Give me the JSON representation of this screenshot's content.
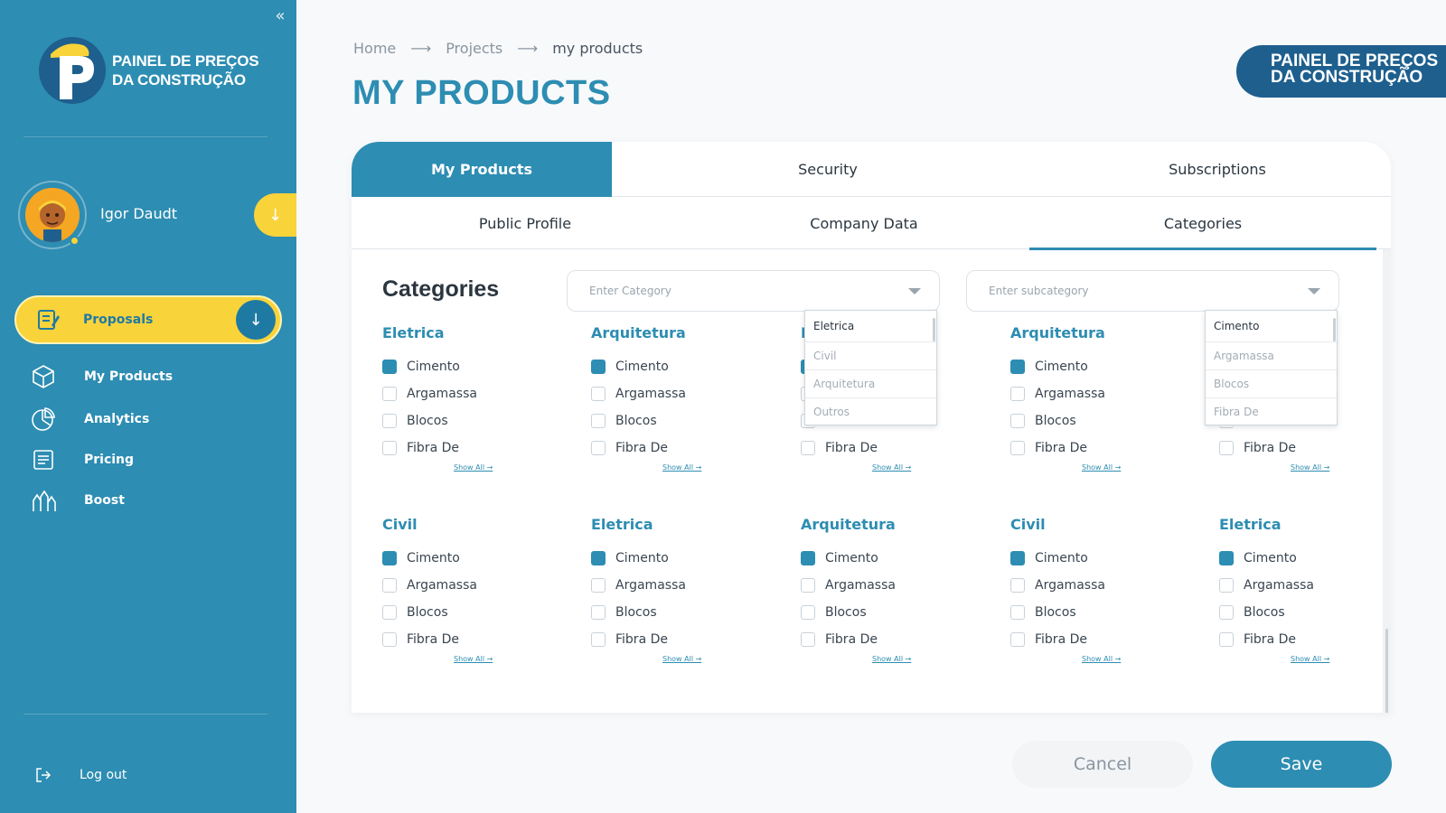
{
  "sidebar": {
    "logo_line1": "PAINEL DE PREÇOS",
    "logo_line2": "DA CONSTRUÇÃO",
    "user_name": "Igor Daudt",
    "proposals_label": "Proposals",
    "items": [
      {
        "label": "My Products",
        "icon": "box-icon"
      },
      {
        "label": "Analytics",
        "icon": "pie-chart-icon"
      },
      {
        "label": "Pricing",
        "icon": "price-list-icon"
      },
      {
        "label": "Boost",
        "icon": "boost-icon"
      }
    ],
    "logout_label": "Log out"
  },
  "breadcrumb": [
    "Home",
    "Projects",
    "my products"
  ],
  "page_title": "MY PRODUCTS",
  "brand_badge": {
    "line1": "PAINEL DE PREÇOS",
    "line2": "DA CONSTRUÇÃO"
  },
  "tabs_top": [
    "My Products",
    "Security",
    "Subscriptions"
  ],
  "tabs_sub": [
    "Public Profile",
    "Company Data",
    "Categories"
  ],
  "categories": {
    "heading": "Categories",
    "category_placeholder": "Enter Category",
    "subcategory_placeholder": "Enter subcategory",
    "show_all_label": "Show All →",
    "category_dropdown": [
      "Eletrica",
      "Civil",
      "Arquitetura",
      "Outros"
    ],
    "subcategory_dropdown": [
      "Cimento",
      "Argamassa",
      "Blocos",
      "Fibra De"
    ],
    "groups": [
      {
        "title": "Eletrica",
        "options": [
          "Cimento",
          "Argamassa",
          "Blocos",
          "Fibra De"
        ],
        "checked": [
          true,
          false,
          false,
          false
        ]
      },
      {
        "title": "Arquitetura",
        "options": [
          "Cimento",
          "Argamassa",
          "Blocos",
          "Fibra De"
        ],
        "checked": [
          true,
          false,
          false,
          false
        ]
      },
      {
        "title": "Eletrica",
        "options": [
          "Cimento",
          "Argamassa",
          "Blocos",
          "Fibra De"
        ],
        "checked": [
          true,
          false,
          false,
          false
        ]
      },
      {
        "title": "Arquitetura",
        "options": [
          "Cimento",
          "Argamassa",
          "Blocos",
          "Fibra De"
        ],
        "checked": [
          true,
          false,
          false,
          false
        ]
      },
      {
        "title": "Eletrica",
        "options": [
          "Cimento",
          "Argamassa",
          "Blocos",
          "Fibra De"
        ],
        "checked": [
          true,
          false,
          false,
          false
        ]
      },
      {
        "title": "Civil",
        "options": [
          "Cimento",
          "Argamassa",
          "Blocos",
          "Fibra De"
        ],
        "checked": [
          true,
          false,
          false,
          false
        ]
      },
      {
        "title": "Eletrica",
        "options": [
          "Cimento",
          "Argamassa",
          "Blocos",
          "Fibra De"
        ],
        "checked": [
          true,
          false,
          false,
          false
        ]
      },
      {
        "title": "Arquitetura",
        "options": [
          "Cimento",
          "Argamassa",
          "Blocos",
          "Fibra De"
        ],
        "checked": [
          true,
          false,
          false,
          false
        ]
      },
      {
        "title": "Civil",
        "options": [
          "Cimento",
          "Argamassa",
          "Blocos",
          "Fibra De"
        ],
        "checked": [
          true,
          false,
          false,
          false
        ]
      },
      {
        "title": "Eletrica",
        "options": [
          "Cimento",
          "Argamassa",
          "Blocos",
          "Fibra De"
        ],
        "checked": [
          true,
          false,
          false,
          false
        ]
      }
    ]
  },
  "actions": {
    "cancel_label": "Cancel",
    "save_label": "Save"
  },
  "colors": {
    "primary": "#2d8db2",
    "accent": "#f9d33a",
    "brand_dark": "#1e5f8e"
  }
}
